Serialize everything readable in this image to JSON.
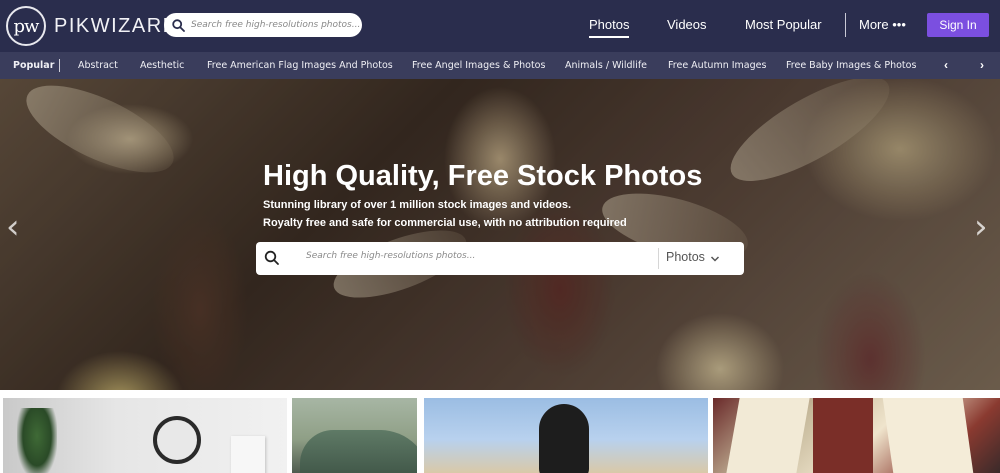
{
  "header": {
    "logo_text": "pw",
    "brand": "PIKWIZARD",
    "search_placeholder": "Search free high-resolutions photos...",
    "nav": {
      "photos": "Photos",
      "videos": "Videos",
      "most_popular": "Most Popular",
      "more": "More •••"
    },
    "sign_in": "Sign In"
  },
  "categories": {
    "items": [
      "Popular",
      "Abstract",
      "Aesthetic",
      "Free American Flag Images And Photos",
      "Free Angel Images & Photos",
      "Animals / Wildlife",
      "Free Autumn Images",
      "Free Baby Images & Photos"
    ],
    "prev_arrow": "‹",
    "next_arrow": "›"
  },
  "hero": {
    "title": "High Quality, Free Stock Photos",
    "subtitle_1": "Stunning library of over 1 million stock images and videos.",
    "subtitle_2": "Royalty free and safe for commercial use, with no attribution required",
    "search_placeholder": "Search free high-resolutions photos...",
    "media_type": "Photos",
    "prev_arrow": "‹",
    "next_arrow": "›"
  },
  "colors": {
    "header_bg": "#2a2d4d",
    "category_bar_bg": "#3a3d5c",
    "sign_in_bg": "#7b4fe0"
  },
  "icons": [
    "logo-icon",
    "search-icon",
    "chevron-down-icon",
    "chevron-left-icon",
    "chevron-right-icon"
  ]
}
